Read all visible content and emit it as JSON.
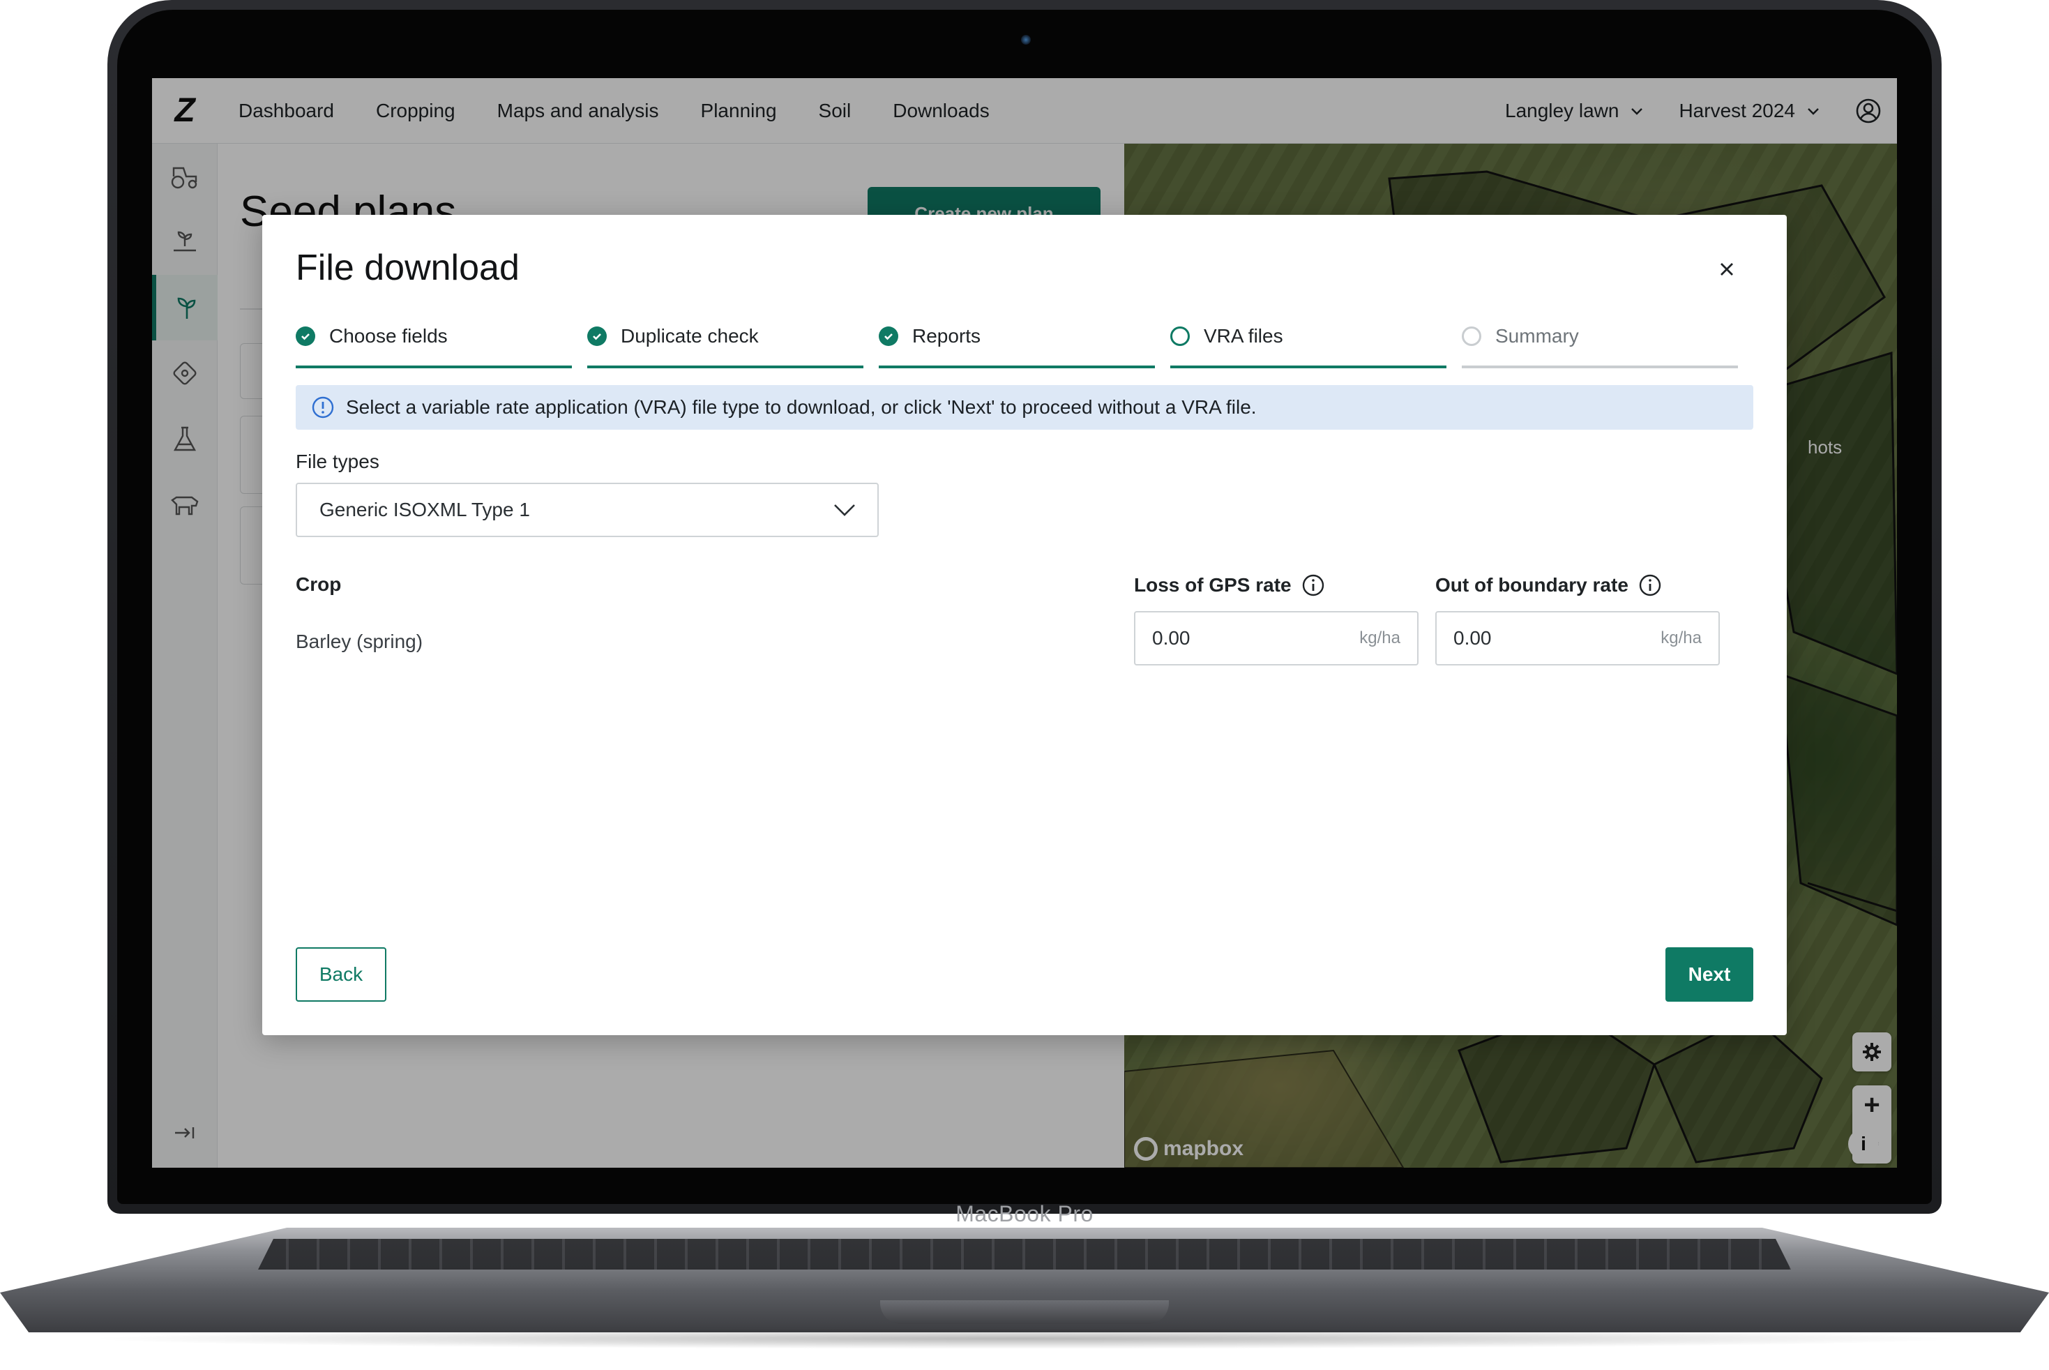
{
  "device": {
    "label": "MacBook Pro"
  },
  "topnav": {
    "logo_text": "Z",
    "items": [
      "Dashboard",
      "Cropping",
      "Maps and analysis",
      "Planning",
      "Soil",
      "Downloads"
    ],
    "farm_select": "Langley lawn",
    "season_select": "Harvest 2024"
  },
  "background_page": {
    "title": "Seed plans",
    "create_button": "Create new plan",
    "map_partial_text": "hots",
    "map_attribution": "mapbox",
    "map_info": "i"
  },
  "modal": {
    "title": "File download",
    "steps": [
      {
        "label": "Choose fields",
        "state": "complete"
      },
      {
        "label": "Duplicate check",
        "state": "complete"
      },
      {
        "label": "Reports",
        "state": "complete"
      },
      {
        "label": "VRA files",
        "state": "current"
      },
      {
        "label": "Summary",
        "state": "pending"
      }
    ],
    "info_message": "Select a variable rate application (VRA) file type to download, or click 'Next' to proceed without a VRA file.",
    "file_types_label": "File types",
    "file_type_selected": "Generic ISOXML Type 1",
    "crop_header": "Crop",
    "crop_value": "Barley (spring)",
    "loss_gps_label": "Loss of GPS rate",
    "loss_gps_value": "0.00",
    "out_of_boundary_label": "Out of boundary rate",
    "out_of_boundary_value": "0.00",
    "unit": "kg/ha",
    "back_label": "Back",
    "next_label": "Next"
  },
  "colors": {
    "brand_green": "#0f7a64",
    "info_banner_bg": "#dde8f6"
  }
}
